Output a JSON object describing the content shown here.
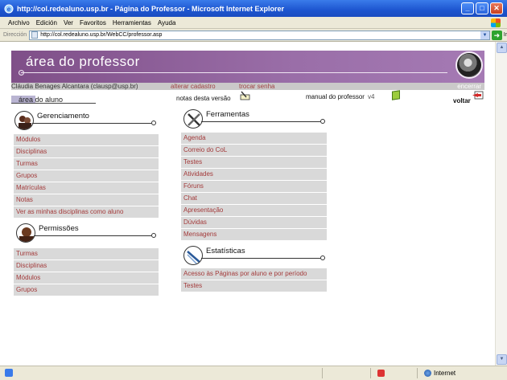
{
  "window": {
    "title": "http://col.redealuno.usp.br - Página do Professor - Microsoft Internet Explorer",
    "min": "_",
    "max": "□",
    "close": "✕"
  },
  "menubar": [
    "Archivo",
    "Edición",
    "Ver",
    "Favoritos",
    "Herramientas",
    "Ayuda"
  ],
  "address": {
    "label": "Dirección",
    "url": "http://col.redealuno.usp.br/WebCC/professor.asp",
    "go": "Ir"
  },
  "banner": {
    "title": "área do professor"
  },
  "user": {
    "name": "Cláudia Benages Alcantara (clausp@usp.br)",
    "alterar": "alterar cadastro",
    "trocar": "trocar senha",
    "encerrar": "encerrar"
  },
  "links": {
    "aluno": "área do aluno",
    "notas": "notas desta versão",
    "manual": "manual do professor",
    "manual_version": "v4",
    "voltar": "voltar"
  },
  "gerenciamento": {
    "title": "Gerenciamento",
    "items": [
      "Módulos",
      "Disciplinas",
      "Turmas",
      "Grupos",
      "Matrículas",
      "Notas",
      "Ver as minhas disciplinas como aluno"
    ]
  },
  "permissoes": {
    "title": "Permissões",
    "items": [
      "Turmas",
      "Disciplinas",
      "Módulos",
      "Grupos"
    ]
  },
  "ferramentas": {
    "title": "Ferramentas",
    "items": [
      "Agenda",
      "Correio do CoL",
      "Testes",
      "Atividades",
      "Fóruns",
      "Chat",
      "Apresentação",
      "Dúvidas",
      "Mensagens"
    ]
  },
  "estatisticas": {
    "title": "Estatísticas",
    "items": [
      "Acesso às Páginas por aluno e por período",
      "Testes"
    ]
  },
  "status": {
    "zone": "Internet"
  }
}
